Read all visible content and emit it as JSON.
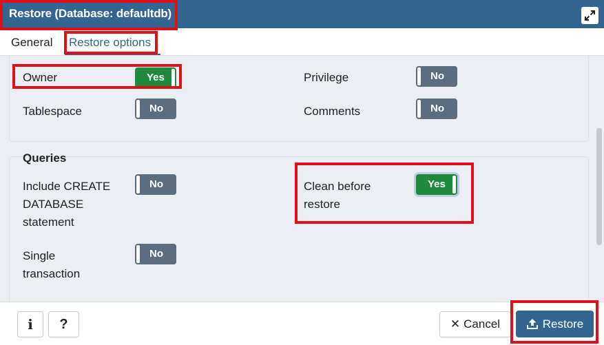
{
  "dialog": {
    "title": "Restore (Database: defaultdb)"
  },
  "tabs": [
    {
      "label": "General",
      "active": false
    },
    {
      "label": "Restore options",
      "active": true
    }
  ],
  "options_section": {
    "owner": {
      "label": "Owner",
      "value": "Yes"
    },
    "privilege": {
      "label": "Privilege",
      "value": "No"
    },
    "tablespace": {
      "label": "Tablespace",
      "value": "No"
    },
    "comments": {
      "label": "Comments",
      "value": "No"
    }
  },
  "queries_section": {
    "title": "Queries",
    "include_create_database": {
      "label_lines": [
        "Include CREATE",
        "DATABASE",
        "statement"
      ],
      "value": "No"
    },
    "clean_before_restore": {
      "label_lines": [
        "Clean before",
        "restore"
      ],
      "value": "Yes"
    },
    "single_transaction": {
      "label_lines": [
        "Single",
        "transaction"
      ],
      "value": "No"
    }
  },
  "footer": {
    "info_label": "i",
    "help_label": "?",
    "cancel_label": "Cancel",
    "cancel_glyph": "✕",
    "restore_label": "Restore"
  },
  "colors": {
    "titlebar": "#326690",
    "toggle_on": "#1f8a3b",
    "toggle_off": "#5b6d7f",
    "highlight": "#e0101a"
  },
  "icons": {
    "expand": "expand-icon",
    "info": "info-icon",
    "help": "help-icon",
    "cancel": "close-icon",
    "restore": "upload-icon"
  }
}
